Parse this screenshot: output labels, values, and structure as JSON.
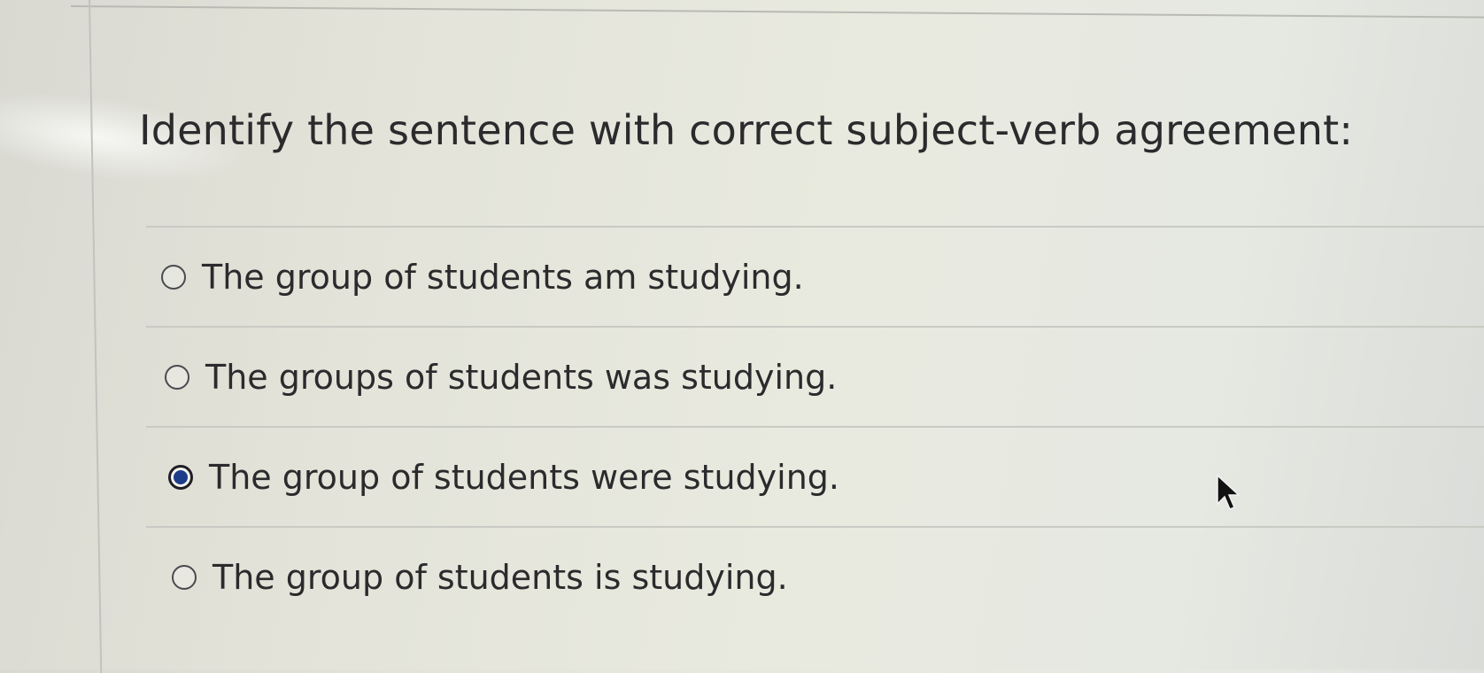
{
  "question": {
    "text": "Identify the sentence with correct subject-verb agreement:"
  },
  "options": [
    {
      "label": "The group of students am studying.",
      "selected": false
    },
    {
      "label": "The groups of students was studying.",
      "selected": false
    },
    {
      "label": "The group of students were studying.",
      "selected": true
    },
    {
      "label": "The group of students is studying.",
      "selected": false
    }
  ],
  "colors": {
    "text": "#2b2b2d",
    "radio_fill": "#1b3d8a",
    "separator": "#c9cac3"
  },
  "icons": {
    "radio_unselected": "radio-empty-icon",
    "radio_selected": "radio-checked-icon",
    "cursor": "mouse-pointer-icon"
  }
}
